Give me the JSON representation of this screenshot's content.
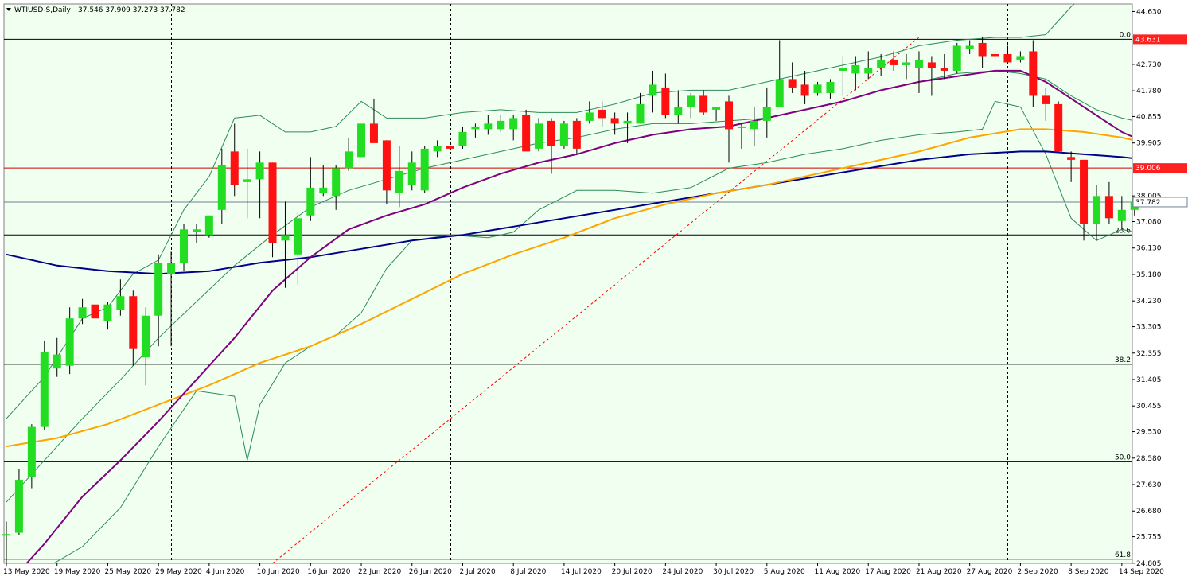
{
  "header": {
    "symbol_label": "WTIUSD-S,Daily",
    "ohlc_label": "37.546 37.909 37.273 37.782"
  },
  "colors": {
    "background": "#f0fff0",
    "bull": "#22dd22",
    "bear": "#ff1111",
    "wick": "#000000",
    "ma_fast": "#800080",
    "ma_mid": "#ffa500",
    "ma_slow": "#00008b",
    "bands": "#2e8b57",
    "fib": "#ff0000",
    "hline_red": "#cc0000",
    "hline": "#000000",
    "price_line": "#708090"
  },
  "chart_data": {
    "type": "candlestick",
    "ylim": [
      24.8,
      44.9
    ],
    "grid": false,
    "y_ticks": [
      "44.630",
      "43.631",
      "42.730",
      "41.780",
      "40.855",
      "39.905",
      "39.006",
      "38.005",
      "37.782",
      "37.080",
      "36.130",
      "35.180",
      "34.230",
      "33.305",
      "32.355",
      "31.405",
      "30.455",
      "29.530",
      "28.580",
      "27.630",
      "26.680",
      "25.755",
      "24.805"
    ],
    "y_tick_values": [
      44.63,
      42.73,
      41.78,
      40.855,
      39.905,
      38.005,
      37.08,
      36.13,
      35.18,
      34.23,
      33.305,
      32.355,
      31.405,
      30.455,
      29.53,
      28.58,
      27.63,
      26.68,
      25.755,
      24.805
    ],
    "x_labels": [
      {
        "text": "13 May 2020",
        "i": 0
      },
      {
        "text": "19 May 2020",
        "i": 4
      },
      {
        "text": "25 May 2020",
        "i": 8
      },
      {
        "text": "29 May 2020",
        "i": 12
      },
      {
        "text": "4 Jun 2020",
        "i": 16
      },
      {
        "text": "10 Jun 2020",
        "i": 20
      },
      {
        "text": "16 Jun 2020",
        "i": 24
      },
      {
        "text": "22 Jun 2020",
        "i": 28
      },
      {
        "text": "26 Jun 2020",
        "i": 32
      },
      {
        "text": "2 Jul 2020",
        "i": 36
      },
      {
        "text": "8 Jul 2020",
        "i": 40
      },
      {
        "text": "14 Jul 2020",
        "i": 44
      },
      {
        "text": "20 Jul 2020",
        "i": 48
      },
      {
        "text": "24 Jul 2020",
        "i": 52
      },
      {
        "text": "30 Jul 2020",
        "i": 56
      },
      {
        "text": "5 Aug 2020",
        "i": 60
      },
      {
        "text": "11 Aug 2020",
        "i": 64
      },
      {
        "text": "17 Aug 2020",
        "i": 68
      },
      {
        "text": "21 Aug 2020",
        "i": 72
      },
      {
        "text": "27 Aug 2020",
        "i": 76
      },
      {
        "text": "2 Sep 2020",
        "i": 80
      },
      {
        "text": "8 Sep 2020",
        "i": 84
      },
      {
        "text": "14 Sep 2020",
        "i": 88
      }
    ],
    "period_separators": [
      13,
      35,
      58,
      79
    ],
    "candles": [
      {
        "o": 25.8,
        "h": 26.3,
        "l": 24.8,
        "c": 25.85
      },
      {
        "o": 25.9,
        "h": 28.2,
        "l": 25.8,
        "c": 27.8
      },
      {
        "o": 27.9,
        "h": 29.8,
        "l": 27.5,
        "c": 29.7
      },
      {
        "o": 29.7,
        "h": 32.8,
        "l": 29.6,
        "c": 32.4
      },
      {
        "o": 31.8,
        "h": 32.9,
        "l": 31.5,
        "c": 32.3
      },
      {
        "o": 31.9,
        "h": 34.0,
        "l": 31.6,
        "c": 33.6
      },
      {
        "o": 33.6,
        "h": 34.3,
        "l": 33.4,
        "c": 34.0
      },
      {
        "o": 34.1,
        "h": 34.2,
        "l": 30.9,
        "c": 33.6
      },
      {
        "o": 33.5,
        "h": 34.2,
        "l": 33.2,
        "c": 34.1
      },
      {
        "o": 33.9,
        "h": 35.0,
        "l": 33.7,
        "c": 34.4
      },
      {
        "o": 34.4,
        "h": 34.6,
        "l": 31.9,
        "c": 32.5
      },
      {
        "o": 32.2,
        "h": 34.0,
        "l": 31.2,
        "c": 33.7
      },
      {
        "o": 33.7,
        "h": 35.9,
        "l": 32.6,
        "c": 35.6
      },
      {
        "o": 35.2,
        "h": 36.0,
        "l": 32.6,
        "c": 35.6
      },
      {
        "o": 35.6,
        "h": 37.0,
        "l": 35.3,
        "c": 36.8
      },
      {
        "o": 36.7,
        "h": 37.0,
        "l": 36.3,
        "c": 36.8
      },
      {
        "o": 36.6,
        "h": 37.3,
        "l": 36.5,
        "c": 37.3
      },
      {
        "o": 37.5,
        "h": 39.7,
        "l": 37.0,
        "c": 39.1
      },
      {
        "o": 39.6,
        "h": 40.6,
        "l": 38.0,
        "c": 38.4
      },
      {
        "o": 38.5,
        "h": 39.7,
        "l": 37.2,
        "c": 38.6
      },
      {
        "o": 38.6,
        "h": 39.6,
        "l": 37.2,
        "c": 39.2
      },
      {
        "o": 39.2,
        "h": 39.2,
        "l": 35.8,
        "c": 36.3
      },
      {
        "o": 36.4,
        "h": 37.8,
        "l": 34.7,
        "c": 36.6
      },
      {
        "o": 35.9,
        "h": 37.4,
        "l": 34.8,
        "c": 37.2
      },
      {
        "o": 37.3,
        "h": 39.4,
        "l": 37.1,
        "c": 38.3
      },
      {
        "o": 38.1,
        "h": 39.1,
        "l": 38.0,
        "c": 38.3
      },
      {
        "o": 38.0,
        "h": 39.1,
        "l": 37.5,
        "c": 39.0
      },
      {
        "o": 39.0,
        "h": 40.1,
        "l": 38.9,
        "c": 39.6
      },
      {
        "o": 39.4,
        "h": 40.6,
        "l": 39.4,
        "c": 40.6
      },
      {
        "o": 40.6,
        "h": 41.5,
        "l": 40.0,
        "c": 39.9
      },
      {
        "o": 40.0,
        "h": 40.0,
        "l": 37.7,
        "c": 38.2
      },
      {
        "o": 38.1,
        "h": 39.8,
        "l": 37.6,
        "c": 38.9
      },
      {
        "o": 38.4,
        "h": 39.6,
        "l": 38.2,
        "c": 39.2
      },
      {
        "o": 38.2,
        "h": 39.8,
        "l": 38.1,
        "c": 39.7
      },
      {
        "o": 39.6,
        "h": 40.0,
        "l": 39.4,
        "c": 39.8
      },
      {
        "o": 39.8,
        "h": 40.7,
        "l": 39.2,
        "c": 39.7
      },
      {
        "o": 39.8,
        "h": 40.5,
        "l": 39.7,
        "c": 40.3
      },
      {
        "o": 40.4,
        "h": 40.6,
        "l": 40.1,
        "c": 40.5
      },
      {
        "o": 40.4,
        "h": 40.9,
        "l": 40.2,
        "c": 40.6
      },
      {
        "o": 40.4,
        "h": 40.9,
        "l": 40.3,
        "c": 40.7
      },
      {
        "o": 40.4,
        "h": 40.9,
        "l": 40.0,
        "c": 40.8
      },
      {
        "o": 40.9,
        "h": 41.1,
        "l": 39.7,
        "c": 39.6
      },
      {
        "o": 39.7,
        "h": 40.8,
        "l": 39.6,
        "c": 40.6
      },
      {
        "o": 40.7,
        "h": 40.8,
        "l": 38.8,
        "c": 39.8
      },
      {
        "o": 39.8,
        "h": 40.7,
        "l": 39.7,
        "c": 40.6
      },
      {
        "o": 40.7,
        "h": 40.8,
        "l": 39.5,
        "c": 39.7
      },
      {
        "o": 40.7,
        "h": 41.4,
        "l": 40.6,
        "c": 41.0
      },
      {
        "o": 41.1,
        "h": 41.4,
        "l": 40.5,
        "c": 40.8
      },
      {
        "o": 40.8,
        "h": 41.0,
        "l": 40.2,
        "c": 40.6
      },
      {
        "o": 40.6,
        "h": 41.0,
        "l": 39.9,
        "c": 40.7
      },
      {
        "o": 40.6,
        "h": 41.7,
        "l": 40.6,
        "c": 41.3
      },
      {
        "o": 41.6,
        "h": 42.5,
        "l": 41.0,
        "c": 42.0
      },
      {
        "o": 41.9,
        "h": 42.4,
        "l": 40.8,
        "c": 40.9
      },
      {
        "o": 40.9,
        "h": 41.8,
        "l": 40.6,
        "c": 41.2
      },
      {
        "o": 41.2,
        "h": 41.7,
        "l": 40.8,
        "c": 41.6
      },
      {
        "o": 41.6,
        "h": 41.8,
        "l": 40.9,
        "c": 41.0
      },
      {
        "o": 41.1,
        "h": 41.2,
        "l": 40.7,
        "c": 41.2
      },
      {
        "o": 41.4,
        "h": 41.6,
        "l": 39.2,
        "c": 40.4
      },
      {
        "o": 40.5,
        "h": 40.6,
        "l": 39.7,
        "c": 40.5
      },
      {
        "o": 40.4,
        "h": 41.2,
        "l": 39.8,
        "c": 40.7
      },
      {
        "o": 40.7,
        "h": 41.9,
        "l": 40.1,
        "c": 41.2
      },
      {
        "o": 41.2,
        "h": 43.6,
        "l": 41.2,
        "c": 42.2
      },
      {
        "o": 42.2,
        "h": 42.8,
        "l": 41.7,
        "c": 41.9
      },
      {
        "o": 42.0,
        "h": 42.5,
        "l": 41.3,
        "c": 41.6
      },
      {
        "o": 41.7,
        "h": 42.1,
        "l": 41.6,
        "c": 42.0
      },
      {
        "o": 41.7,
        "h": 42.2,
        "l": 41.5,
        "c": 42.1
      },
      {
        "o": 42.5,
        "h": 43.0,
        "l": 41.6,
        "c": 42.6
      },
      {
        "o": 42.4,
        "h": 43.0,
        "l": 41.8,
        "c": 42.7
      },
      {
        "o": 42.4,
        "h": 43.2,
        "l": 42.2,
        "c": 42.6
      },
      {
        "o": 42.6,
        "h": 43.1,
        "l": 42.3,
        "c": 42.9
      },
      {
        "o": 42.9,
        "h": 43.2,
        "l": 42.5,
        "c": 42.7
      },
      {
        "o": 42.7,
        "h": 43.1,
        "l": 42.2,
        "c": 42.8
      },
      {
        "o": 42.6,
        "h": 43.2,
        "l": 41.7,
        "c": 42.9
      },
      {
        "o": 42.8,
        "h": 43.0,
        "l": 41.6,
        "c": 42.6
      },
      {
        "o": 42.6,
        "h": 43.1,
        "l": 42.2,
        "c": 42.5
      },
      {
        "o": 42.5,
        "h": 43.5,
        "l": 42.4,
        "c": 43.4
      },
      {
        "o": 43.3,
        "h": 43.6,
        "l": 43.1,
        "c": 43.4
      },
      {
        "o": 43.5,
        "h": 43.7,
        "l": 42.6,
        "c": 43.0
      },
      {
        "o": 43.1,
        "h": 43.3,
        "l": 42.9,
        "c": 43.0
      },
      {
        "o": 43.1,
        "h": 43.4,
        "l": 42.9,
        "c": 42.8
      },
      {
        "o": 42.9,
        "h": 43.2,
        "l": 42.8,
        "c": 43.0
      },
      {
        "o": 43.2,
        "h": 43.6,
        "l": 41.2,
        "c": 41.6
      },
      {
        "o": 41.6,
        "h": 41.9,
        "l": 40.7,
        "c": 41.3
      },
      {
        "o": 41.3,
        "h": 41.4,
        "l": 39.8,
        "c": 39.6
      },
      {
        "o": 39.4,
        "h": 39.6,
        "l": 38.5,
        "c": 39.3
      },
      {
        "o": 39.3,
        "h": 39.3,
        "l": 36.4,
        "c": 37.0
      },
      {
        "o": 37.0,
        "h": 38.4,
        "l": 36.4,
        "c": 38.0
      },
      {
        "o": 38.0,
        "h": 38.5,
        "l": 37.0,
        "c": 37.2
      },
      {
        "o": 37.1,
        "h": 38.0,
        "l": 36.8,
        "c": 37.5
      },
      {
        "o": 37.5,
        "h": 37.9,
        "l": 37.3,
        "c": 37.8
      }
    ],
    "ma_fast": [
      [
        0,
        24.0
      ],
      [
        3,
        25.5
      ],
      [
        6,
        27.2
      ],
      [
        9,
        28.5
      ],
      [
        12,
        29.9
      ],
      [
        15,
        31.4
      ],
      [
        18,
        32.9
      ],
      [
        21,
        34.6
      ],
      [
        24,
        35.8
      ],
      [
        27,
        36.8
      ],
      [
        30,
        37.3
      ],
      [
        33,
        37.7
      ],
      [
        36,
        38.3
      ],
      [
        39,
        38.8
      ],
      [
        42,
        39.2
      ],
      [
        45,
        39.5
      ],
      [
        48,
        39.9
      ],
      [
        51,
        40.2
      ],
      [
        54,
        40.4
      ],
      [
        57,
        40.5
      ],
      [
        60,
        40.8
      ],
      [
        63,
        41.1
      ],
      [
        66,
        41.4
      ],
      [
        69,
        41.8
      ],
      [
        72,
        42.1
      ],
      [
        75,
        42.3
      ],
      [
        78,
        42.5
      ],
      [
        80,
        42.5
      ],
      [
        82,
        42.1
      ],
      [
        85,
        41.2
      ],
      [
        88,
        40.3
      ],
      [
        90,
        39.9
      ]
    ],
    "ma_mid": [
      [
        0,
        29.0
      ],
      [
        4,
        29.3
      ],
      [
        8,
        29.8
      ],
      [
        12,
        30.5
      ],
      [
        16,
        31.2
      ],
      [
        20,
        32.0
      ],
      [
        24,
        32.6
      ],
      [
        28,
        33.4
      ],
      [
        32,
        34.3
      ],
      [
        36,
        35.2
      ],
      [
        40,
        35.9
      ],
      [
        44,
        36.5
      ],
      [
        48,
        37.2
      ],
      [
        52,
        37.7
      ],
      [
        56,
        38.1
      ],
      [
        60,
        38.4
      ],
      [
        64,
        38.8
      ],
      [
        68,
        39.2
      ],
      [
        72,
        39.6
      ],
      [
        76,
        40.1
      ],
      [
        80,
        40.4
      ],
      [
        82,
        40.4
      ],
      [
        85,
        40.3
      ],
      [
        88,
        40.1
      ],
      [
        90,
        39.9
      ]
    ],
    "ma_slow": [
      [
        0,
        35.9
      ],
      [
        4,
        35.5
      ],
      [
        8,
        35.3
      ],
      [
        12,
        35.2
      ],
      [
        16,
        35.3
      ],
      [
        20,
        35.6
      ],
      [
        24,
        35.8
      ],
      [
        28,
        36.1
      ],
      [
        32,
        36.4
      ],
      [
        36,
        36.6
      ],
      [
        40,
        36.9
      ],
      [
        44,
        37.2
      ],
      [
        48,
        37.5
      ],
      [
        52,
        37.8
      ],
      [
        56,
        38.1
      ],
      [
        60,
        38.4
      ],
      [
        64,
        38.7
      ],
      [
        68,
        39.0
      ],
      [
        72,
        39.3
      ],
      [
        76,
        39.5
      ],
      [
        80,
        39.6
      ],
      [
        82,
        39.6
      ],
      [
        85,
        39.5
      ],
      [
        88,
        39.4
      ],
      [
        90,
        39.3
      ]
    ],
    "band_upper": [
      [
        0,
        30.0
      ],
      [
        3,
        31.5
      ],
      [
        6,
        33.6
      ],
      [
        8,
        34.0
      ],
      [
        10,
        35.2
      ],
      [
        12,
        35.7
      ],
      [
        14,
        37.5
      ],
      [
        16,
        38.7
      ],
      [
        18,
        40.8
      ],
      [
        20,
        40.9
      ],
      [
        22,
        40.3
      ],
      [
        24,
        40.3
      ],
      [
        26,
        40.5
      ],
      [
        28,
        41.4
      ],
      [
        30,
        40.8
      ],
      [
        33,
        40.8
      ],
      [
        36,
        41.0
      ],
      [
        39,
        41.1
      ],
      [
        42,
        41.0
      ],
      [
        45,
        41.0
      ],
      [
        48,
        41.3
      ],
      [
        51,
        41.7
      ],
      [
        54,
        41.8
      ],
      [
        57,
        41.8
      ],
      [
        60,
        42.1
      ],
      [
        63,
        42.4
      ],
      [
        66,
        42.7
      ],
      [
        69,
        43.0
      ],
      [
        72,
        43.4
      ],
      [
        75,
        43.6
      ],
      [
        78,
        43.7
      ],
      [
        80,
        43.7
      ],
      [
        82,
        43.8
      ],
      [
        84,
        44.8
      ],
      [
        85,
        45.2
      ]
    ],
    "band_mid": [
      [
        0,
        27.0
      ],
      [
        3,
        28.5
      ],
      [
        6,
        30.0
      ],
      [
        9,
        31.4
      ],
      [
        12,
        32.9
      ],
      [
        15,
        34.2
      ],
      [
        18,
        35.5
      ],
      [
        21,
        36.6
      ],
      [
        24,
        37.6
      ],
      [
        27,
        38.2
      ],
      [
        30,
        38.6
      ],
      [
        33,
        39.0
      ],
      [
        36,
        39.3
      ],
      [
        39,
        39.6
      ],
      [
        42,
        39.9
      ],
      [
        45,
        40.1
      ],
      [
        48,
        40.4
      ],
      [
        51,
        40.6
      ],
      [
        54,
        40.6
      ],
      [
        57,
        40.7
      ],
      [
        60,
        40.8
      ],
      [
        63,
        41.1
      ],
      [
        66,
        41.4
      ],
      [
        69,
        41.8
      ],
      [
        72,
        42.1
      ],
      [
        75,
        42.4
      ],
      [
        78,
        42.5
      ],
      [
        80,
        42.4
      ],
      [
        82,
        42.2
      ],
      [
        84,
        41.6
      ],
      [
        86,
        41.1
      ],
      [
        88,
        40.8
      ],
      [
        90,
        40.6
      ]
    ],
    "band_lower": [
      [
        0,
        24.0
      ],
      [
        3,
        24.6
      ],
      [
        6,
        25.4
      ],
      [
        9,
        26.8
      ],
      [
        12,
        29.0
      ],
      [
        15,
        31.0
      ],
      [
        18,
        30.8
      ],
      [
        19,
        28.5
      ],
      [
        20,
        30.5
      ],
      [
        22,
        32.0
      ],
      [
        24,
        32.6
      ],
      [
        26,
        33.0
      ],
      [
        28,
        33.8
      ],
      [
        30,
        35.4
      ],
      [
        32,
        36.4
      ],
      [
        35,
        36.6
      ],
      [
        38,
        36.5
      ],
      [
        40,
        36.7
      ],
      [
        42,
        37.5
      ],
      [
        45,
        38.2
      ],
      [
        48,
        38.2
      ],
      [
        51,
        38.1
      ],
      [
        54,
        38.3
      ],
      [
        57,
        39.0
      ],
      [
        60,
        39.2
      ],
      [
        63,
        39.5
      ],
      [
        66,
        39.7
      ],
      [
        69,
        40.0
      ],
      [
        72,
        40.2
      ],
      [
        75,
        40.3
      ],
      [
        77,
        40.4
      ],
      [
        78,
        41.4
      ],
      [
        80,
        41.2
      ],
      [
        82,
        39.5
      ],
      [
        84,
        37.2
      ],
      [
        86,
        36.4
      ],
      [
        88,
        36.8
      ],
      [
        90,
        36.6
      ]
    ],
    "fib_line": [
      [
        21,
        24.8
      ],
      [
        72,
        43.7
      ]
    ],
    "levels": [
      {
        "price": 43.631,
        "label": "0.0",
        "color": "hline"
      },
      {
        "price": 36.6,
        "label": "23.6",
        "color": "hline"
      },
      {
        "price": 31.95,
        "label": "38.2",
        "color": "hline"
      },
      {
        "price": 28.45,
        "label": "50.0",
        "color": "hline"
      },
      {
        "price": 24.95,
        "label": "61.8",
        "color": "hline"
      }
    ],
    "red_level": {
      "price": 39.006,
      "label": "39.006"
    },
    "price_level": {
      "price": 37.782,
      "label": "37.782"
    },
    "top_label": {
      "price": 43.631,
      "label": "43.631"
    }
  }
}
